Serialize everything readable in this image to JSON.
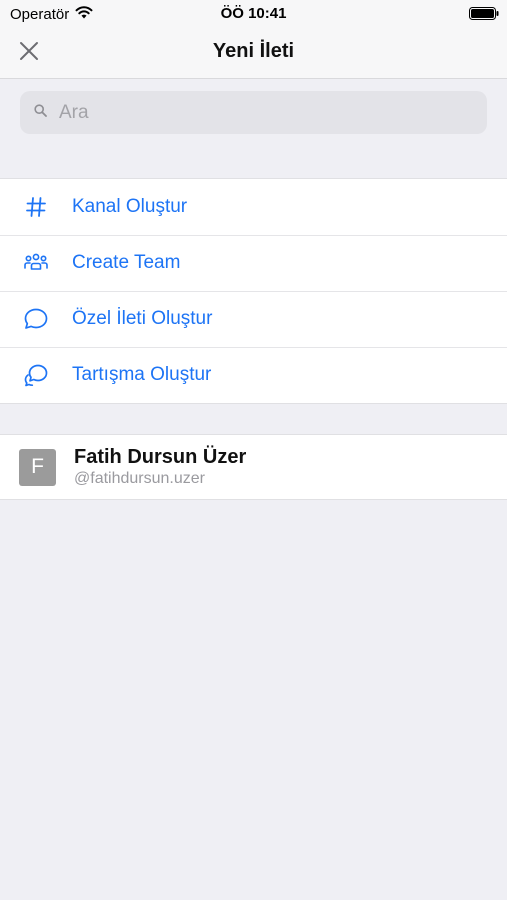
{
  "status_bar": {
    "carrier": "Operatör",
    "time": "ÖÖ 10:41"
  },
  "nav": {
    "title": "Yeni İleti",
    "close_icon": "close-icon"
  },
  "search": {
    "placeholder": "Ara",
    "value": ""
  },
  "actions": [
    {
      "label": "Kanal Oluştur",
      "icon": "hashtag-icon"
    },
    {
      "label": "Create Team",
      "icon": "team-icon"
    },
    {
      "label": "Özel İleti Oluştur",
      "icon": "chat-bubble-icon"
    },
    {
      "label": "Tartışma Oluştur",
      "icon": "discussion-icon"
    }
  ],
  "users": [
    {
      "initial": "F",
      "name": "Fatih Dursun Üzer",
      "username": "@fatihdursun.uzer"
    }
  ],
  "colors": {
    "accent": "#1d74f5",
    "background": "#efeff4",
    "avatar": "#9b9b9b"
  }
}
